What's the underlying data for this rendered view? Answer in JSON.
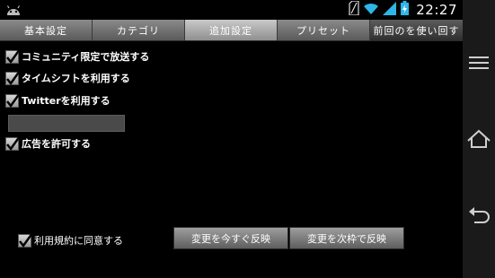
{
  "status_bar": {
    "time": "22:27",
    "icons": [
      "android-icon",
      "sd-card-icon",
      "wifi-icon",
      "signal-icon",
      "battery-charging-icon"
    ]
  },
  "tabs": [
    {
      "label": "基本設定",
      "state": "normal"
    },
    {
      "label": "カテゴリ",
      "state": "normal"
    },
    {
      "label": "追加設定",
      "state": "active"
    },
    {
      "label": "プリセット",
      "state": "normal"
    },
    {
      "label": "前回のを使い回す",
      "state": "dim"
    }
  ],
  "options": {
    "community_only": {
      "label": "コミュニティ限定で放送する",
      "checked": true
    },
    "timeshift": {
      "label": "タイムシフトを利用する",
      "checked": true
    },
    "twitter": {
      "label": "Twitterを利用する",
      "checked": true
    },
    "twitter_text": {
      "value": ""
    },
    "ads": {
      "label": "広告を許可する",
      "checked": true
    }
  },
  "footer": {
    "terms": {
      "label": "利用規約に同意する",
      "checked": true
    },
    "apply_now_label": "変更を今すぐ反映",
    "apply_next_label": "変更を次枠で反映"
  },
  "nav_bar": {
    "icons": [
      "menu-icon",
      "home-icon",
      "back-icon"
    ]
  }
}
